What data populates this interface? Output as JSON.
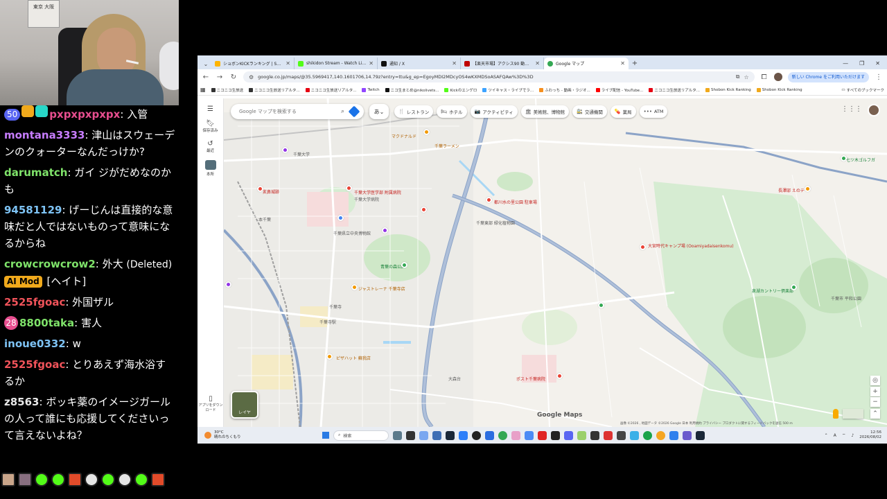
{
  "webcam": {
    "poster_text": "東京 大阪"
  },
  "chat": {
    "messages": [
      {
        "user": "pxpxpxpxpx",
        "color": "#e74e8f",
        "badges": [
          "50"
        ],
        "text": "入管"
      },
      {
        "user": "montana3333",
        "color": "#c77dff",
        "text": "津山はスウェーデンのクォーターなんだっけか?"
      },
      {
        "user": "darumatch",
        "color": "#7fe36a",
        "text": "ガイ ジがだめなのかも"
      },
      {
        "user": "94581129",
        "color": "#7ec3f5",
        "text": "げーじんは直接的な意味だと人ではないものって意味になるからね"
      },
      {
        "user": "crowcrowcrow2",
        "color": "#7fe36a",
        "text": "外大",
        "deleted_label": "(Deleted)",
        "mod_label": "AI Mod",
        "tail": "[ヘイト]"
      },
      {
        "user": "2525fgoac",
        "color": "#f0535a",
        "text": "外国ザル"
      },
      {
        "user": "8800taka",
        "color": "#7fe36a",
        "badges": [
          "28"
        ],
        "text": "害人"
      },
      {
        "user": "inoue0332",
        "color": "#7ec3f5",
        "text": "w"
      },
      {
        "user": "2525fgoac",
        "color": "#f0535a",
        "text": "とりあえず海水浴するか"
      },
      {
        "user": "z8563",
        "color": "#e8e8e8",
        "text": "ボッキ薬のイメージガールの人って誰にも応援してくださいって言えないよね？"
      }
    ]
  },
  "browser": {
    "tabs": [
      {
        "title": "ショボンKICKランキング | Shobon Ki...",
        "color": "#ffb400",
        "active": false
      },
      {
        "title": "shikidon Stream - Watch Live o...",
        "color": "#53fc18",
        "active": false
      },
      {
        "title": "通知 / X",
        "color": "#111111",
        "active": false
      },
      {
        "title": "【楽天市場】アクシス90 動画本の送...",
        "color": "#bf0000",
        "active": false
      },
      {
        "title": "Google マップ",
        "color": "#34a853",
        "active": true
      }
    ],
    "url": "google.co.jp/maps/@35.5969417,140.1601706,14.79z?entry=ttu&g_ep=EgoyMDI2MDcyOS4wKXMDSoASAFQAw%3D%3D",
    "chrome_promo": "新しい Chrome をご利用いただけます",
    "bookmarks": [
      {
        "label": "ニコニコ生放送",
        "color": "#333333"
      },
      {
        "label": "ニコニコ生放送リアルタ...",
        "color": "#333333"
      },
      {
        "label": "ニコニコ生放送リアルタ...",
        "color": "#e60012"
      },
      {
        "label": "Twitch",
        "color": "#9146ff"
      },
      {
        "label": "ニコ生まとめ@nikolivets...",
        "color": "#111111"
      },
      {
        "label": "Kickのエンゲロ",
        "color": "#53fc18"
      },
      {
        "label": "ツイキャス・ライブでラ...",
        "color": "#3da3ff"
      },
      {
        "label": "ふわっち - 動画・ラジオ...",
        "color": "#f58f1f"
      },
      {
        "label": "ライブ配信 - YouTube...",
        "color": "#ff0000"
      },
      {
        "label": "ニコニコ生放送リアルタ...",
        "color": "#e60012"
      },
      {
        "label": "Shobon Kick Ranking",
        "color": "#f0a91c"
      },
      {
        "label": "Shobon Kick Ranking",
        "color": "#f0a91c"
      }
    ],
    "all_bookmarks": "すべてのブックマーク"
  },
  "maps": {
    "search_placeholder": "Google マップを検索する",
    "lang_btn": "あ",
    "chips": [
      {
        "icon": "🍴",
        "label": "レストラン"
      },
      {
        "icon": "🛏",
        "label": "ホテル"
      },
      {
        "icon": "📷",
        "label": "アクティビティ"
      },
      {
        "icon": "🏛",
        "label": "美術館、博物館"
      },
      {
        "icon": "🚉",
        "label": "交通機関"
      },
      {
        "icon": "💊",
        "label": "薬局"
      },
      {
        "icon": "•••",
        "label": "ATM"
      }
    ],
    "rail": {
      "saved": "保存済み",
      "recent": "最近",
      "history": "本所"
    },
    "app_download": "アプリをダウンロード",
    "layer_label": "レイヤ",
    "google_logo": "Google Maps",
    "scale_text": "画像 ©2026 , 地図データ ©2026 Google  日本  利用規約  プライバシー  プロダクトに関するフィードバックを送信  500 m",
    "labels": [
      {
        "text": "千葉大学医学部 附属病院",
        "cls": "red"
      },
      {
        "text": "千葉大学",
        "cls": ""
      },
      {
        "text": "千葉県立中央博物館",
        "cls": ""
      },
      {
        "text": "都川水の里公園 駐車場",
        "cls": "red"
      },
      {
        "text": "千葉東部 緑化植物園",
        "cls": ""
      },
      {
        "text": "大宮時代キャンプ場 (Ooamiyadaisenkomu)",
        "cls": "red"
      },
      {
        "text": "青葉の森公園",
        "cls": ""
      },
      {
        "text": "ジャストレーナ 千葉寺店",
        "cls": "orange"
      },
      {
        "text": "ピザハット 蘇我店",
        "cls": "orange"
      },
      {
        "text": "ポスト千葉病院",
        "cls": "red"
      },
      {
        "text": "泉湖カントリー倶楽部",
        "cls": ""
      },
      {
        "text": "千葉市 平和公園",
        "cls": ""
      },
      {
        "text": "亥鼻城跡",
        "cls": "red"
      },
      {
        "text": "千葉寺駅",
        "cls": ""
      },
      {
        "text": "大森台",
        "cls": ""
      },
      {
        "text": "千葉寺",
        "cls": ""
      },
      {
        "text": "七ツ木ゴルフガ",
        "cls": ""
      },
      {
        "text": "長澤邸 えのテー",
        "cls": "red"
      },
      {
        "text": "マクドナルド",
        "cls": "orange"
      },
      {
        "text": "千葉ラーメン",
        "cls": "orange"
      },
      {
        "text": "千葉大学病院",
        "cls": ""
      },
      {
        "text": "本千葉",
        "cls": ""
      }
    ]
  },
  "taskbar": {
    "weather_temp": "30°C",
    "weather_text": "晴れのちくもり",
    "search_label": "検索",
    "time": "12:56",
    "date": "2026/08/02",
    "ime": "A"
  }
}
